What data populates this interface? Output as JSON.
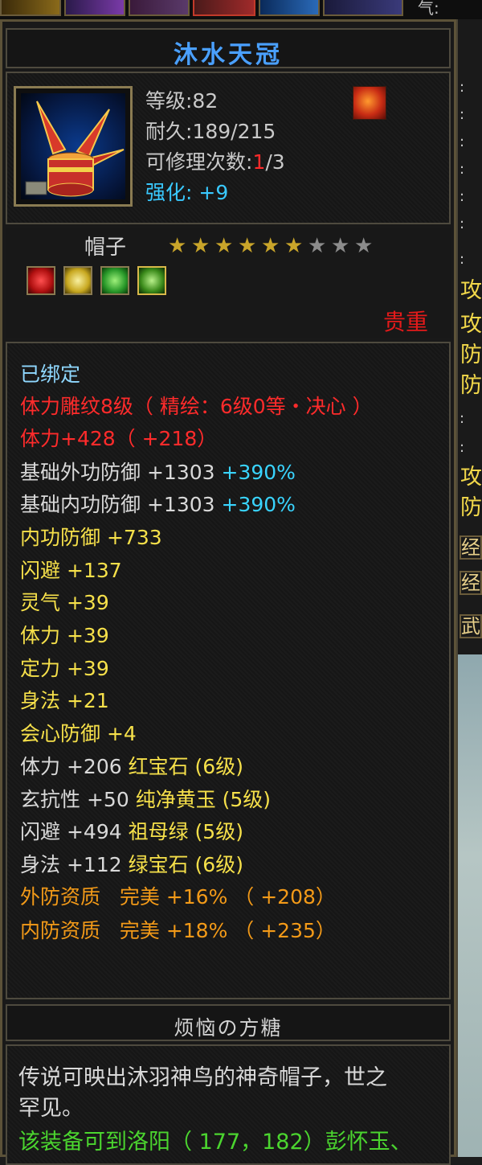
{
  "top": {
    "qi_label": "气:"
  },
  "right_panel": {
    "chars": [
      "攻",
      "攻",
      "防",
      "防",
      "攻",
      "防"
    ],
    "boxes": [
      "经",
      "经",
      "武"
    ]
  },
  "item": {
    "name": "沐水天冠",
    "level": "等级:82",
    "durability": {
      "label": "耐久:",
      "value": "189/215"
    },
    "repair": {
      "label": "可修理次数:",
      "used": "1",
      "total": "/3"
    },
    "enhance": {
      "label": "强化:",
      "value": "+9"
    },
    "type": "帽子",
    "stars": {
      "filled": 6,
      "total": 9
    },
    "gems": [
      "ruby-gem-icon",
      "yellow-jade-gem-icon",
      "emerald-gem-icon",
      "green-gem-icon"
    ],
    "rarity": "贵重"
  },
  "attributes": {
    "bound": "已绑定",
    "engrave": "体力雕纹8级（ 精绘：6级0等・决心 ）",
    "stamina_engrave": "体力+428（ +218）",
    "rows": [
      {
        "name": "基础外功防御",
        "value": "+1303",
        "extra": "+390%"
      },
      {
        "name": "基础内功防御",
        "value": "+1303",
        "extra": "+390%"
      },
      {
        "name": "内功防御",
        "value": "+733"
      },
      {
        "name": "闪避",
        "value": "+137"
      },
      {
        "name": "灵气",
        "value": "+39"
      },
      {
        "name": "体力",
        "value": "+39"
      },
      {
        "name": "定力",
        "value": "+39"
      },
      {
        "name": "身法",
        "value": "+21"
      },
      {
        "name": "会心防御",
        "value": "+4"
      }
    ],
    "gem_rows": [
      {
        "name": "体力",
        "value": "+206",
        "gem": "红宝石 (6级)"
      },
      {
        "name": "玄抗性",
        "value": "+50",
        "gem": "纯净黄玉 (5级)"
      },
      {
        "name": "闪避",
        "value": "+494",
        "gem": "祖母绿 (5级)"
      },
      {
        "name": "身法",
        "value": "+112",
        "gem": "绿宝石 (6级)"
      }
    ],
    "quality_rows": [
      {
        "name": "外防资质",
        "grade": "完美",
        "value": "+16% （ +208）"
      },
      {
        "name": "内防资质",
        "grade": "完美",
        "value": "+18% （ +235）"
      }
    ]
  },
  "maker": "烦恼の方糖",
  "description": {
    "line1": "传说可映出沐羽神鸟的神奇帽子，世之",
    "line2": "罕见。",
    "line3": "该装备可到洛阳（ 177，182）彭怀玉、"
  },
  "colors": {
    "title": "#4aa0ff",
    "red": "#ff2b2b",
    "yellow": "#f6e04a",
    "cyan": "#39d4ff",
    "orange": "#f39a18",
    "green": "#4bd52f",
    "star_filled": "#c9a52a",
    "star_empty": "#8c8c8c"
  }
}
